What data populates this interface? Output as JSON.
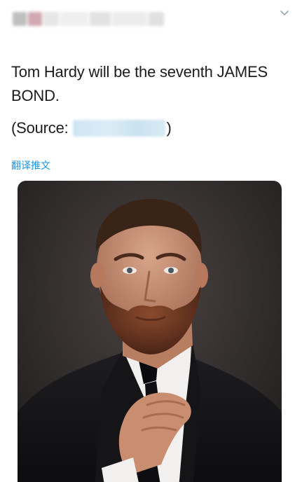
{
  "tweet": {
    "text_line_1": "Tom Hardy will be the seventh JAMES BOND.",
    "source_prefix": "(Source: ",
    "source_suffix": ")",
    "translate_label": "翻译推文"
  },
  "icons": {
    "menu": "chevron-down-icon"
  },
  "colors": {
    "link": "#1b95e0",
    "text": "#1c1c1c"
  }
}
